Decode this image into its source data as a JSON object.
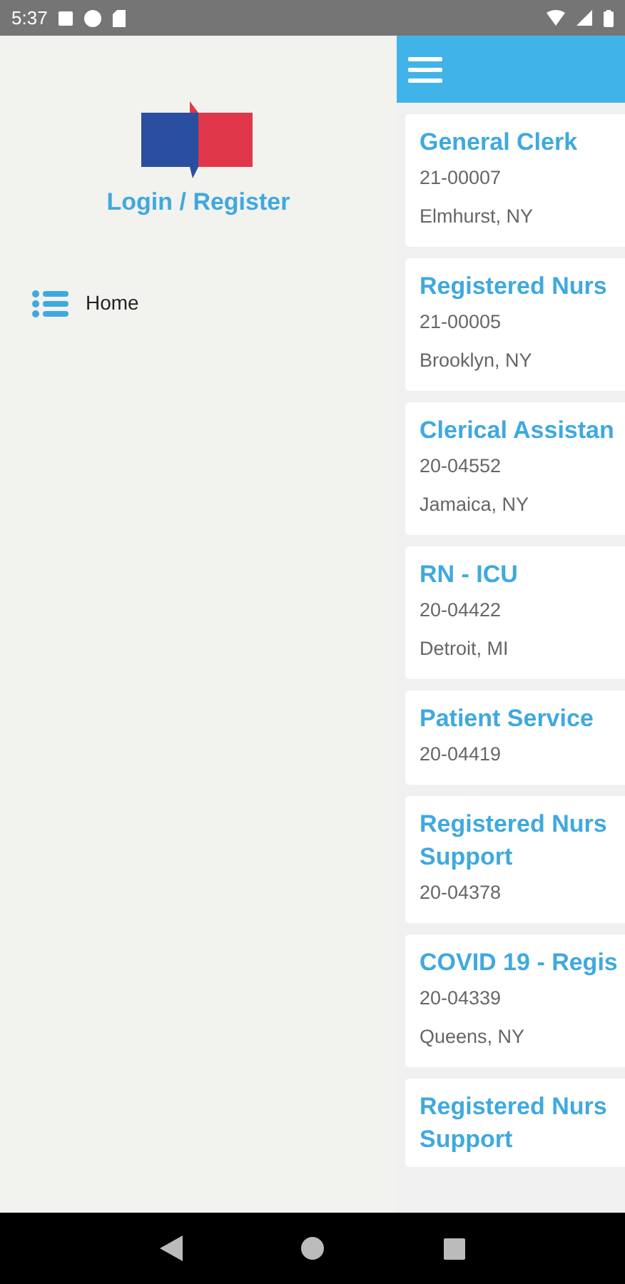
{
  "status_bar": {
    "time": "5:37"
  },
  "drawer": {
    "login_link": "Login / Register",
    "items": [
      {
        "label": "Home"
      }
    ]
  },
  "jobs": [
    {
      "title_lines": [
        "General Clerk"
      ],
      "code": "21-00007",
      "location": "Elmhurst, NY"
    },
    {
      "title_lines": [
        "Registered Nurs"
      ],
      "code": "21-00005",
      "location": "Brooklyn, NY"
    },
    {
      "title_lines": [
        "Clerical Assistan"
      ],
      "code": "20-04552",
      "location": "Jamaica, NY"
    },
    {
      "title_lines": [
        "RN - ICU"
      ],
      "code": "20-04422",
      "location": "Detroit, MI"
    },
    {
      "title_lines": [
        "Patient Service"
      ],
      "code": "20-04419"
    },
    {
      "title_lines": [
        "Registered Nurs",
        "Support"
      ],
      "code": "20-04378"
    },
    {
      "title_lines": [
        "COVID 19 - Regis"
      ],
      "code": "20-04339",
      "location": "Queens, NY"
    },
    {
      "title_lines": [
        "Registered Nurs",
        "Support"
      ]
    }
  ]
}
